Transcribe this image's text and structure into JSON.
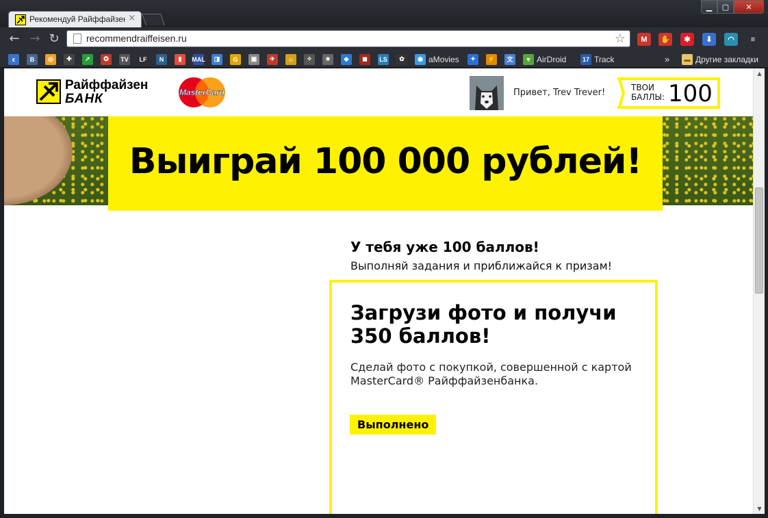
{
  "browser": {
    "tab_title": "Рекомендуй Райффайзен",
    "tab_close": "×",
    "url": "recommendraiffeisen.ru",
    "window_controls": {
      "minimize": "▁",
      "maximize": "▢",
      "close": "✕"
    },
    "extensions": [
      {
        "name": "gmail-icon",
        "label": "M",
        "color": "#c7372a"
      },
      {
        "name": "adblock-icon",
        "label": "✋",
        "color": "#d0342c"
      },
      {
        "name": "lastpass-icon",
        "label": "✱",
        "color": "#d81f2a"
      },
      {
        "name": "download-icon",
        "label": "⬇",
        "color": "#3a6fd0"
      },
      {
        "name": "globe-icon",
        "label": "◠",
        "color": "#2a8fb0"
      },
      {
        "name": "menu-icon",
        "label": "≡",
        "color": "#2b2e34"
      }
    ]
  },
  "bookmarks": {
    "items": [
      {
        "name": "bookmark-icon-1",
        "label": "",
        "icon": "ϵ",
        "color": "#3b73c9"
      },
      {
        "name": "bookmark-vk",
        "label": "",
        "icon": "B",
        "color": "#45668e"
      },
      {
        "name": "bookmark-icon-3",
        "label": "",
        "icon": "◎",
        "color": "#f0a020"
      },
      {
        "name": "bookmark-icon-4",
        "label": "",
        "icon": "✚",
        "color": "#444"
      },
      {
        "name": "bookmark-icon-5",
        "label": "",
        "icon": "➚",
        "color": "#2a9b3b"
      },
      {
        "name": "bookmark-icon-6",
        "label": "",
        "icon": "✪",
        "color": "#c0392b"
      },
      {
        "name": "bookmark-tv",
        "label": "",
        "icon": "TV",
        "color": "#555"
      },
      {
        "name": "bookmark-lf",
        "label": "",
        "icon": "LF",
        "color": "#2b2e34"
      },
      {
        "name": "bookmark-n",
        "label": "",
        "icon": "N",
        "color": "#2d5f8a"
      },
      {
        "name": "bookmark-bars",
        "label": "",
        "icon": "▮",
        "color": "#e74c3c"
      },
      {
        "name": "bookmark-mal",
        "label": "",
        "icon": "MAL",
        "color": "#2e51a2"
      },
      {
        "name": "bookmark-icon-12",
        "label": "",
        "icon": "◨",
        "color": "#3d7ed6"
      },
      {
        "name": "bookmark-g",
        "label": "",
        "icon": "G",
        "color": "#e0a800"
      },
      {
        "name": "bookmark-icon-14",
        "label": "",
        "icon": "▣",
        "color": "#888"
      },
      {
        "name": "bookmark-icon-15",
        "label": "",
        "icon": "✈",
        "color": "#c0392b"
      },
      {
        "name": "bookmark-icon-16",
        "label": "",
        "icon": "☺",
        "color": "#d4a017"
      },
      {
        "name": "bookmark-icon-17",
        "label": "",
        "icon": "✧",
        "color": "#555"
      },
      {
        "name": "bookmark-star",
        "label": "",
        "icon": "★",
        "color": "#666"
      },
      {
        "name": "bookmark-icon-19",
        "label": "",
        "icon": "◆",
        "color": "#2b7bd6"
      },
      {
        "name": "bookmark-dota",
        "label": "",
        "icon": "◼",
        "color": "#a42a1b"
      },
      {
        "name": "bookmark-ls",
        "label": "",
        "icon": "LS",
        "color": "#2c7fb8"
      },
      {
        "name": "bookmark-icon-22",
        "label": "",
        "icon": "✿",
        "color": "#333"
      },
      {
        "name": "bookmark-amovies",
        "label": "aMovies",
        "icon": "◉",
        "color": "#3b9be0"
      },
      {
        "name": "bookmark-icon-24",
        "label": "",
        "icon": "✦",
        "color": "#2b6fd6"
      },
      {
        "name": "bookmark-icon-25",
        "label": "",
        "icon": "⚡",
        "color": "#e08a00"
      },
      {
        "name": "bookmark-translate",
        "label": "",
        "icon": "文",
        "color": "#4a7fd6"
      },
      {
        "name": "bookmark-airdroid",
        "label": "AirDroid",
        "icon": "▼",
        "color": "#57a639"
      },
      {
        "name": "bookmark-track",
        "label": "Track",
        "icon": "17",
        "color": "#2a5da8"
      }
    ],
    "overflow": "»",
    "other_folder": "Другие закладки"
  },
  "header": {
    "bank_name": "Райффайзен",
    "bank_sub": "БАНК",
    "card_brand": "MasterCard",
    "greeting": "Привет, Trev Trever!",
    "points_label_1": "ТВОИ",
    "points_label_2": "БАЛЛЫ:",
    "points_value": "100"
  },
  "hero": {
    "title": "Выиграй 100 000 рублей!"
  },
  "intro": {
    "title": "У тебя уже 100 баллов!",
    "subtitle": "Выполняй задания и приближайся к призам!"
  },
  "task": {
    "title": "Загрузи фото и получи 350 баллов!",
    "description": "Сделай фото с покупкой, совершенной с картой MasterCard® Райффайзенбанка.",
    "button": "Выполнено"
  },
  "colors": {
    "brand_yellow": "#fff200",
    "chrome_dark": "#2b2e34"
  }
}
